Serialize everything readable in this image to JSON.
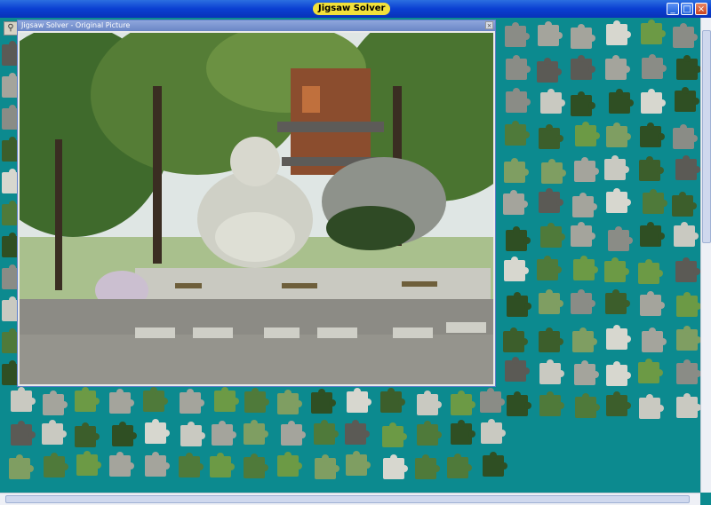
{
  "window": {
    "title": "Jigsaw Solver",
    "controls": [
      "_",
      "□",
      "×"
    ]
  },
  "picture_window": {
    "title": "Jigsaw Solver - Original Picture",
    "close": "×"
  },
  "colors": {
    "workspace": "#0c8a8f",
    "titlebar": "#0a3fd2",
    "title_badge": "#f2e13a"
  }
}
